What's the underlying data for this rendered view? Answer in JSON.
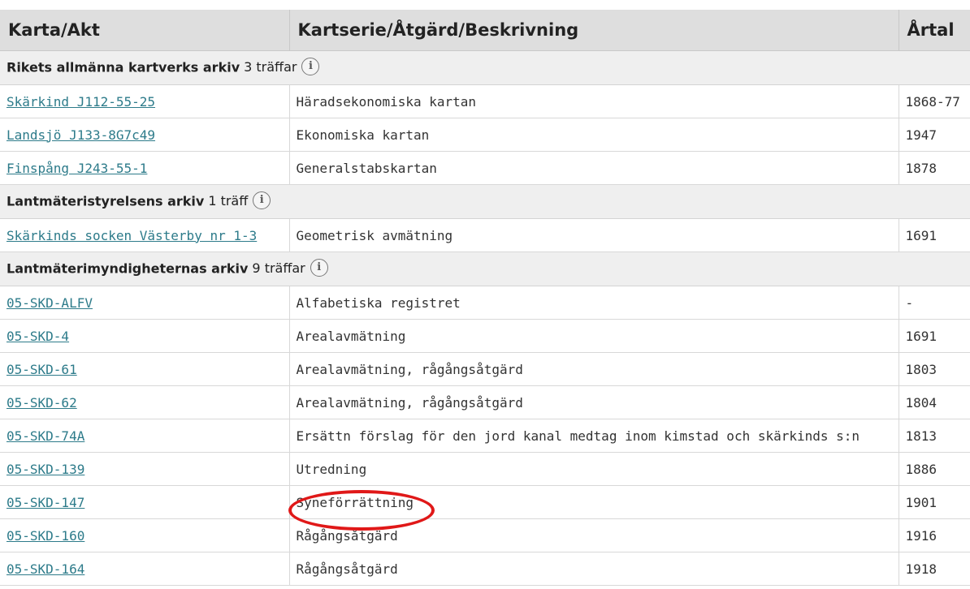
{
  "headers": {
    "col1": "Karta/Akt",
    "col2": "Kartserie/Åtgärd/Beskrivning",
    "col3": "Årtal"
  },
  "groups": [
    {
      "name": "Rikets allmänna kartverks arkiv",
      "count": "3 träffar",
      "rows": [
        {
          "akt": "Skärkind J112-55-25",
          "beskrivning": "Häradsekonomiska kartan",
          "artal": "1868-77"
        },
        {
          "akt": "Landsjö J133-8G7c49",
          "beskrivning": "Ekonomiska kartan",
          "artal": "1947"
        },
        {
          "akt": "Finspång J243-55-1",
          "beskrivning": "Generalstabskartan",
          "artal": "1878"
        }
      ]
    },
    {
      "name": "Lantmäteristyrelsens arkiv",
      "count": "1 träff",
      "rows": [
        {
          "akt": "Skärkinds socken Västerby nr 1-3",
          "beskrivning": "Geometrisk avmätning",
          "artal": "1691"
        }
      ]
    },
    {
      "name": "Lantmäterimyndigheternas arkiv",
      "count": "9 träffar",
      "rows": [
        {
          "akt": "05-SKD-ALFV",
          "beskrivning": "Alfabetiska registret",
          "artal": "-"
        },
        {
          "akt": "05-SKD-4",
          "beskrivning": "Arealavmätning",
          "artal": "1691"
        },
        {
          "akt": "05-SKD-61",
          "beskrivning": "Arealavmätning, rågångsåtgärd",
          "artal": "1803"
        },
        {
          "akt": "05-SKD-62",
          "beskrivning": "Arealavmätning, rågångsåtgärd",
          "artal": "1804"
        },
        {
          "akt": "05-SKD-74A",
          "beskrivning": "Ersättn förslag för den jord kanal medtag inom kimstad och skärkinds s:n",
          "artal": "1813"
        },
        {
          "akt": "05-SKD-139",
          "beskrivning": "Utredning",
          "artal": "1886"
        },
        {
          "akt": "05-SKD-147",
          "beskrivning": "Syneförrättning",
          "artal": "1901"
        },
        {
          "akt": "05-SKD-160",
          "beskrivning": "Rågångsåtgärd",
          "artal": "1916"
        },
        {
          "akt": "05-SKD-164",
          "beskrivning": "Rågångsåtgärd",
          "artal": "1918"
        }
      ]
    }
  ],
  "info_icon": "info-icon",
  "highlight_color": "#e01818",
  "link_color": "#2d7b8a"
}
